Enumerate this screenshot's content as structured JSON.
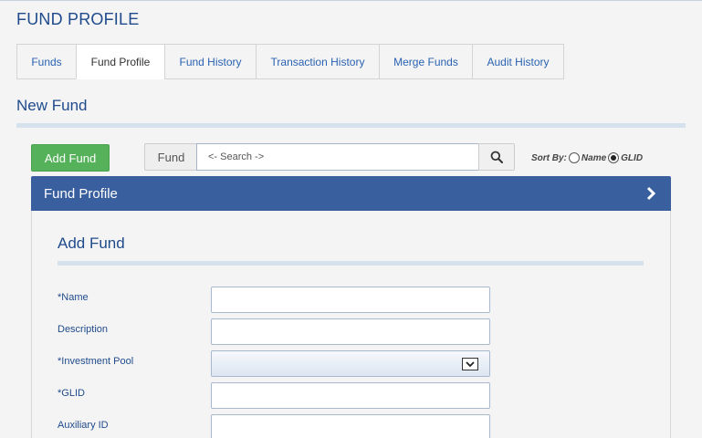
{
  "page": {
    "title": "FUND PROFILE",
    "section_title": "New Fund"
  },
  "tabs": [
    {
      "label": "Funds",
      "active": false
    },
    {
      "label": "Fund Profile",
      "active": true
    },
    {
      "label": "Fund History",
      "active": false
    },
    {
      "label": "Transaction History",
      "active": false
    },
    {
      "label": "Merge Funds",
      "active": false
    },
    {
      "label": "Audit History",
      "active": false
    }
  ],
  "toolbar": {
    "add_label": "Add Fund",
    "fund_label": "Fund",
    "search_value": "<- Search ->",
    "sort_by_label": "Sort By:",
    "sort_options": [
      {
        "label": "Name",
        "checked": false
      },
      {
        "label": "GLID",
        "checked": true
      }
    ]
  },
  "panel": {
    "title": "Fund Profile"
  },
  "form": {
    "title": "Add Fund",
    "fields": [
      {
        "label": "*Name",
        "value": ""
      },
      {
        "label": "Description",
        "value": ""
      },
      {
        "label": "*Investment Pool",
        "value": ""
      },
      {
        "label": "*GLID",
        "value": ""
      },
      {
        "label": "Auxiliary ID",
        "value": ""
      }
    ]
  },
  "colors": {
    "title_blue": "#1f4a8c",
    "link_blue": "#2a62b2",
    "add_green": "#55b25a",
    "panel_header": "#3a5f9f"
  },
  "icons": {
    "search": "search-icon",
    "chevron": "chevron-right-icon",
    "dropdown": "chevron-down-icon"
  }
}
